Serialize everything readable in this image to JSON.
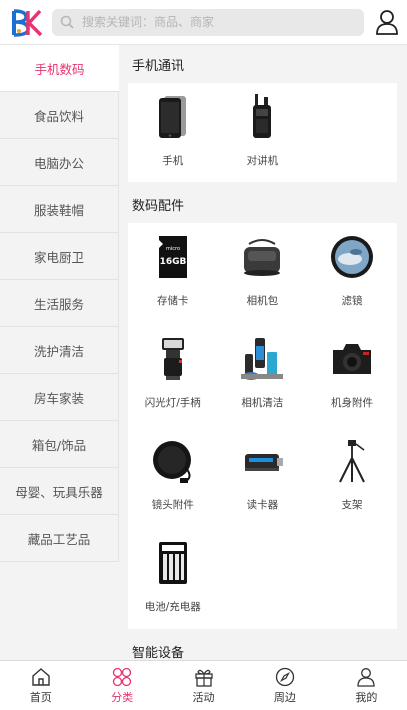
{
  "header": {
    "logo_text": "BK",
    "search_placeholder": "搜索关键词：商品、商家"
  },
  "sidebar": {
    "items": [
      {
        "label": "手机数码",
        "active": true
      },
      {
        "label": "食品饮料"
      },
      {
        "label": "电脑办公"
      },
      {
        "label": "服装鞋帽"
      },
      {
        "label": "家电厨卫"
      },
      {
        "label": "生活服务"
      },
      {
        "label": "洗护清洁"
      },
      {
        "label": "房车家装"
      },
      {
        "label": "箱包/饰品"
      },
      {
        "label": "母婴、玩具乐器"
      },
      {
        "label": "藏品工艺品"
      }
    ]
  },
  "sections": [
    {
      "title": "手机通讯",
      "items": [
        {
          "label": "手机",
          "icon": "smartphone-icon"
        },
        {
          "label": "对讲机",
          "icon": "walkie-talkie-icon"
        }
      ]
    },
    {
      "title": "数码配件",
      "items": [
        {
          "label": "存储卡",
          "icon": "memory-card-icon"
        },
        {
          "label": "相机包",
          "icon": "camera-bag-icon"
        },
        {
          "label": "滤镜",
          "icon": "lens-filter-icon"
        },
        {
          "label": "闪光灯/手柄",
          "icon": "flash-icon"
        },
        {
          "label": "相机清洁",
          "icon": "camera-cleaning-kit-icon"
        },
        {
          "label": "机身附件",
          "icon": "camera-body-icon"
        },
        {
          "label": "镜头附件",
          "icon": "lens-cap-icon"
        },
        {
          "label": "读卡器",
          "icon": "card-reader-icon"
        },
        {
          "label": "支架",
          "icon": "tripod-icon"
        },
        {
          "label": "电池/充电器",
          "icon": "battery-charger-icon"
        }
      ]
    },
    {
      "title": "智能设备",
      "items": []
    }
  ],
  "tabbar": {
    "items": [
      {
        "label": "首页",
        "icon": "home-icon"
      },
      {
        "label": "分类",
        "icon": "category-icon",
        "active": true
      },
      {
        "label": "活动",
        "icon": "gift-icon"
      },
      {
        "label": "周边",
        "icon": "compass-icon"
      },
      {
        "label": "我的",
        "icon": "user-icon"
      }
    ]
  },
  "colors": {
    "accent": "#e8336d",
    "logo_blue": "#1e6fd1",
    "logo_pink": "#e8336d"
  }
}
